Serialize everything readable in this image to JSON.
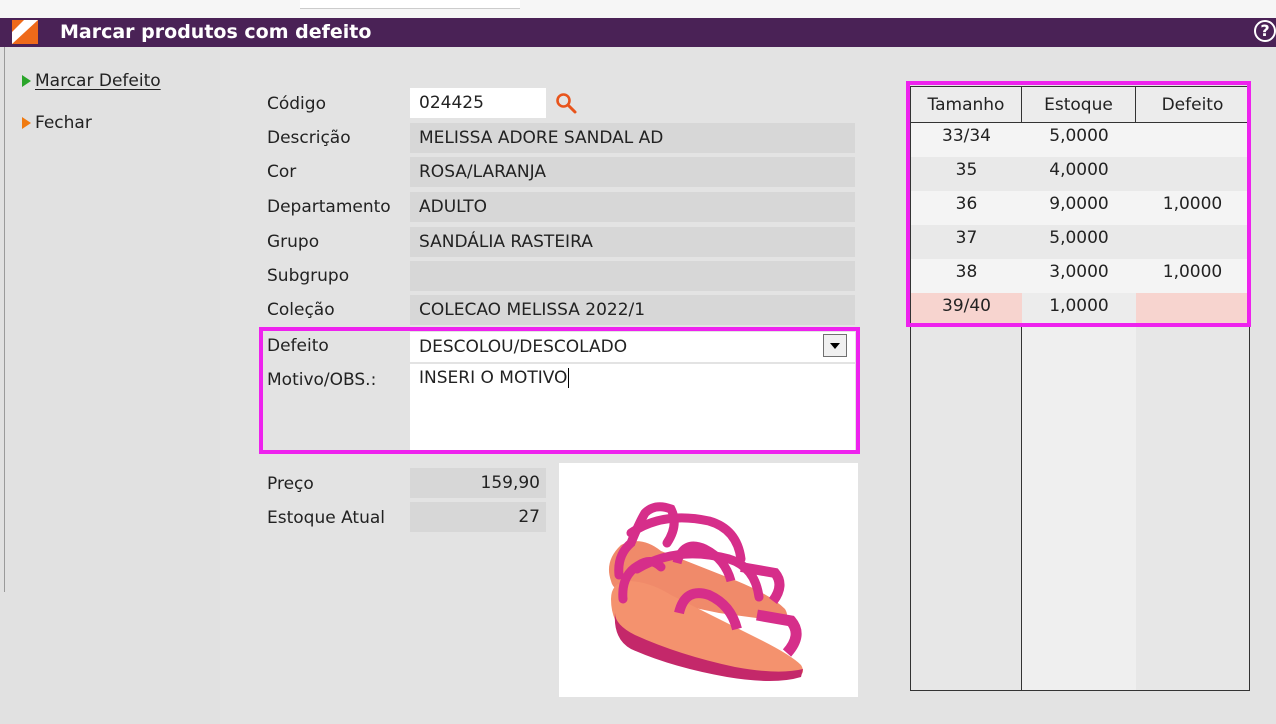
{
  "window": {
    "title": "Marcar produtos com defeito",
    "help_glyph": "?"
  },
  "sidebar": {
    "items": [
      {
        "label": "Marcar Defeito",
        "color": "#2aa52a"
      },
      {
        "label": "Fechar",
        "color": "#f07a10"
      }
    ]
  },
  "form": {
    "codigo": {
      "label": "Código",
      "value": "024425"
    },
    "descricao": {
      "label": "Descrição",
      "value": "MELISSA ADORE SANDAL AD"
    },
    "cor": {
      "label": "Cor",
      "value": "ROSA/LARANJA"
    },
    "departamento": {
      "label": "Departamento",
      "value": "ADULTO"
    },
    "grupo": {
      "label": "Grupo",
      "value": "SANDÁLIA RASTEIRA"
    },
    "subgrupo": {
      "label": "Subgrupo",
      "value": ""
    },
    "colecao": {
      "label": "Coleção",
      "value": "COLECAO MELISSA 2022/1"
    },
    "defeito": {
      "label": "Defeito",
      "value": "DESCOLOU/DESCOLADO"
    },
    "motivo": {
      "label": "Motivo/OBS.:",
      "value": "INSERI O MOTIVO"
    },
    "preco": {
      "label": "Preço",
      "value": "159,90"
    },
    "estoque_atual": {
      "label": "Estoque Atual",
      "value": "27"
    }
  },
  "grid": {
    "headers": [
      "Tamanho",
      "Estoque",
      "Defeito"
    ],
    "rows": [
      {
        "tamanho": "33/34",
        "estoque": "5,0000",
        "defeito": ""
      },
      {
        "tamanho": "35",
        "estoque": "4,0000",
        "defeito": ""
      },
      {
        "tamanho": "36",
        "estoque": "9,0000",
        "defeito": "1,0000"
      },
      {
        "tamanho": "37",
        "estoque": "5,0000",
        "defeito": ""
      },
      {
        "tamanho": "38",
        "estoque": "3,0000",
        "defeito": "1,0000"
      },
      {
        "tamanho": "39/40",
        "estoque": "1,0000",
        "defeito": ""
      }
    ],
    "selected_row_color": "#f7d4cf"
  },
  "colors": {
    "titlebar": "#4a2256",
    "highlight": "#ee22ee",
    "sandal": "#d62e8a",
    "sole": "#f08a6a"
  },
  "icons": [
    "app-logo-icon",
    "help-icon",
    "play-arrow-icon",
    "search-icon",
    "dropdown-arrow-icon"
  ]
}
